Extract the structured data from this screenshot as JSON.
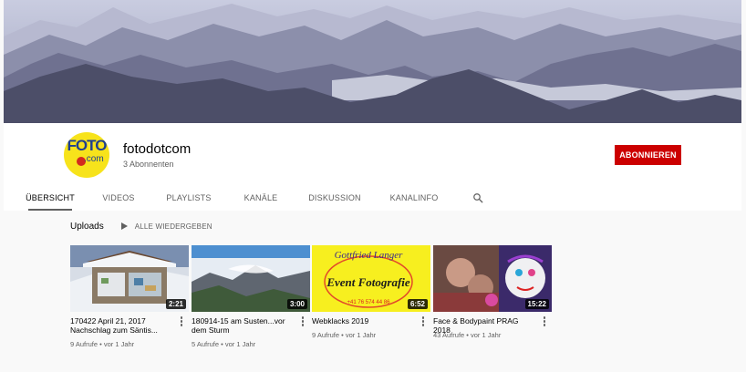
{
  "channel": {
    "name": "fotodotcom",
    "subscribers": "3 Abonnenten",
    "avatar_text_main": "FOTO",
    "avatar_text_sub": ".com",
    "subscribe_label": "ABONNIEREN",
    "subscribe_color": "#cc0000"
  },
  "tabs": [
    {
      "label": "ÜBERSICHT",
      "active": true
    },
    {
      "label": "VIDEOS",
      "active": false
    },
    {
      "label": "PLAYLISTS",
      "active": false
    },
    {
      "label": "KANÄLE",
      "active": false
    },
    {
      "label": "DISKUSSION",
      "active": false
    },
    {
      "label": "KANALINFO",
      "active": false
    }
  ],
  "search_icon": "search-icon",
  "uploads": {
    "title": "Uploads",
    "play_all_label": "ALLE WIEDERGEBEN",
    "videos": [
      {
        "title": "170422 April 21, 2017 Nachschlag zum Säntis...",
        "duration": "2:21",
        "meta": "9 Aufrufe • vor 1 Jahr"
      },
      {
        "title": "180914-15 am Susten...vor dem Sturm",
        "duration": "3:00",
        "meta": "5 Aufrufe • vor 1 Jahr"
      },
      {
        "title": "Webklacks 2019",
        "duration": "6:52",
        "meta": "9 Aufrufe • vor 1 Jahr",
        "thumb_text_1": "Gottfried Langer",
        "thumb_text_2": "Event Fotografie",
        "thumb_text_3": "+41 76 574 44 86"
      },
      {
        "title": "Face & Bodypaint PRAG 2018",
        "duration": "15:22",
        "meta": "43 Aufrufe • vor 1 Jahr"
      }
    ]
  }
}
